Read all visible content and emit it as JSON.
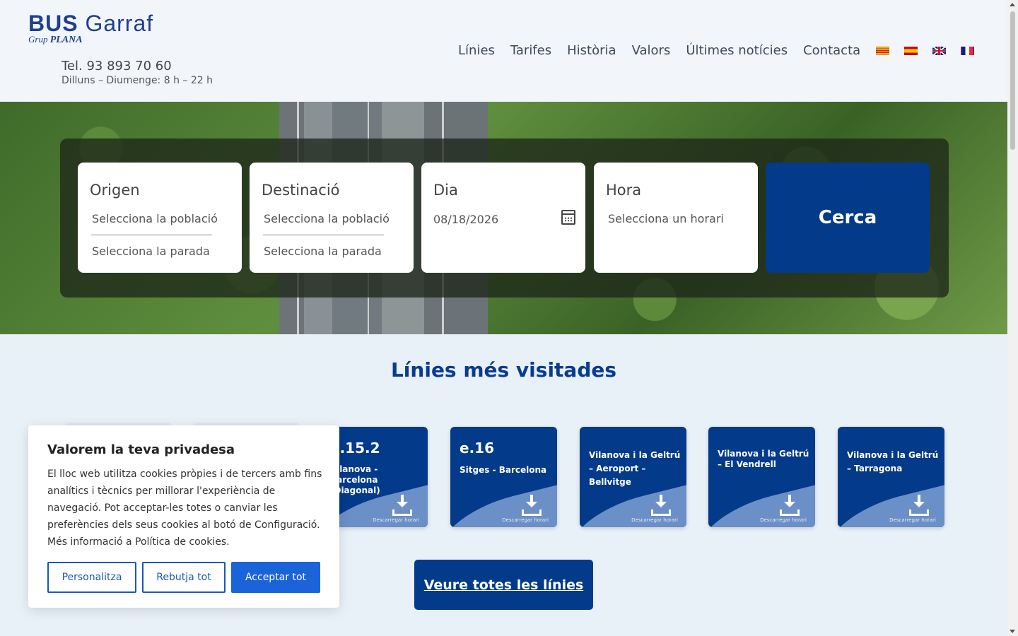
{
  "brand": {
    "logo_main_1": "BUS",
    "logo_main_2": "Garraf",
    "logo_sub_1": "Grup",
    "logo_sub_2": "PLANA",
    "phone": "Tel. 93 893 70 60",
    "hours": "Dilluns – Diumenge: 8 h – 22 h",
    "primary_color": "#033a8a"
  },
  "nav": {
    "items": [
      "Línies",
      "Tarifes",
      "Història",
      "Valors",
      "Últimes notícies",
      "Contacta"
    ],
    "languages": [
      "flag-catalan-icon",
      "flag-spain-icon",
      "flag-uk-icon",
      "flag-france-icon"
    ]
  },
  "search": {
    "origin": {
      "title": "Origen",
      "town": "Selecciona la població",
      "stop": "Selecciona la parada"
    },
    "destination": {
      "title": "Destinació",
      "town": "Selecciona la població",
      "stop": "Selecciona la parada"
    },
    "day": {
      "title": "Dia",
      "value": "08/18/2026"
    },
    "time": {
      "title": "Hora",
      "value": "Selecciona un horari"
    },
    "button": "Cerca"
  },
  "lines": {
    "title": "Línies més visitades",
    "download_label": "Descarregar horari",
    "cards": [
      {
        "code": "e.15.2",
        "route": "Vilanova - Barcelona (Diagonal)"
      },
      {
        "code": "e.16",
        "route": "Sitges - Barcelona"
      },
      {
        "code": "",
        "route": "Vilanova i la Geltrú – Aeroport – Bellvitge"
      },
      {
        "code": "",
        "route": "Vilanova i la Geltrú – El Vendrell"
      },
      {
        "code": "",
        "route": "Vilanova i la Geltrú – Tarragona"
      }
    ],
    "all_button": "Veure totes les línies"
  },
  "cookie": {
    "title": "Valorem la teva privadesa",
    "text": "El lloc web utilitza cookies pròpies i de tercers amb fins analítics i tècnics per millorar l'experiència de navegació. Pot acceptar-les totes o canviar les preferències dels seus cookies al botó de Configuració. Més informació a Política de cookies.",
    "customize": "Personalitza",
    "reject": "Rebutja tot",
    "accept": "Acceptar tot"
  }
}
